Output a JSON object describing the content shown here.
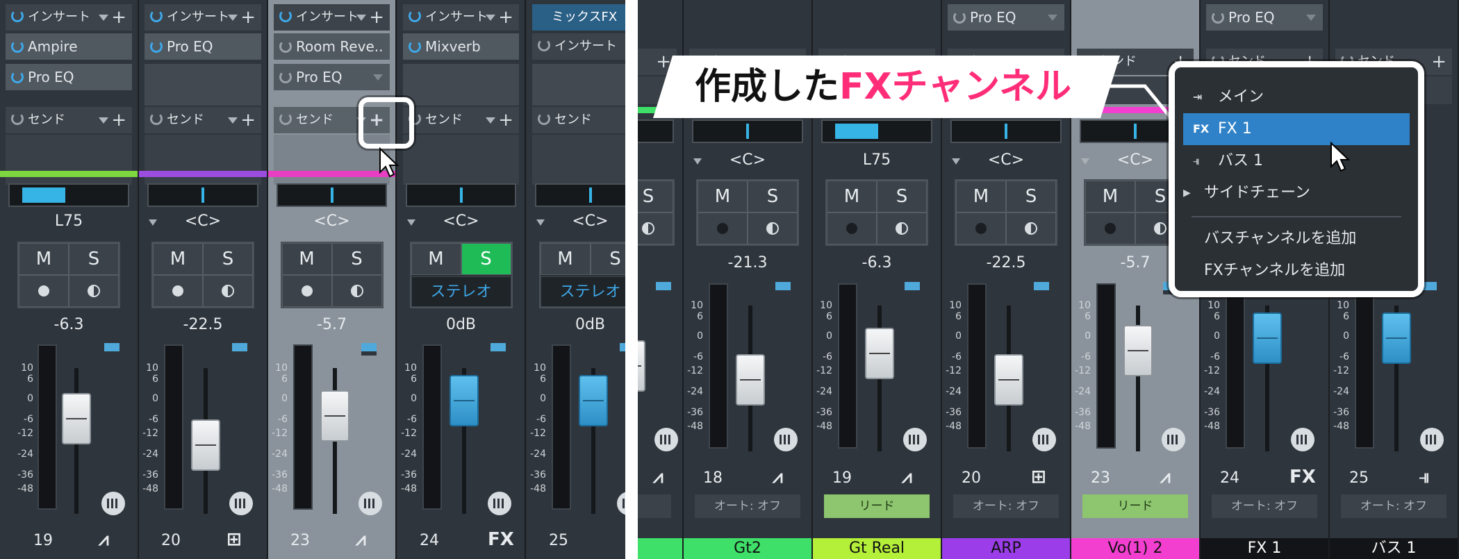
{
  "left": {
    "strips": [
      {
        "insert_label": "インサート",
        "plugins": [
          "Ampire",
          "Pro EQ"
        ],
        "send_label": "センド",
        "color": "#7ed640",
        "pan_label": "L75",
        "mute": "M",
        "solo": "S",
        "volume": "-6.3",
        "scale": [
          "10",
          "6",
          "0",
          "-6",
          "-12",
          "-24",
          "-36",
          "-48"
        ],
        "number": "19",
        "type_icon": "waveform-icon"
      },
      {
        "insert_label": "インサート",
        "plugins": [
          "Pro EQ"
        ],
        "send_label": "センド",
        "color": "#9b4de0",
        "pan_label": "<C>",
        "mute": "M",
        "solo": "S",
        "volume": "-22.5",
        "scale": [
          "10",
          "6",
          "0",
          "-6",
          "-12",
          "-24",
          "-36",
          "-48"
        ],
        "number": "20",
        "type_icon": "keyboard-icon"
      },
      {
        "insert_label": "インサート",
        "plugins": [
          "Room Reve..",
          "Pro EQ"
        ],
        "send_label": "センド",
        "color": "#e83ec2",
        "pan_label": "<C>",
        "mute": "M",
        "solo": "S",
        "volume": "-5.7",
        "scale": [
          "10",
          "6",
          "0",
          "-6",
          "-12",
          "-24",
          "-36",
          "-48"
        ],
        "number": "23",
        "type_icon": "waveform-icon"
      },
      {
        "insert_label": "インサート",
        "plugins": [
          "Mixverb"
        ],
        "send_label": "センド",
        "color": "#2c3137",
        "pan_label": "<C>",
        "mute": "M",
        "solo": "S",
        "stereo": "ステレオ",
        "volume": "0dB",
        "scale": [
          "10",
          "6",
          "0",
          "-6",
          "-12",
          "-24",
          "-36",
          "-48"
        ],
        "number": "24",
        "type_icon": "FX"
      },
      {
        "header": "ミックスFX",
        "insert_label": "インサート",
        "send_label": "センド",
        "color": "#2c3137",
        "pan_label": "<C>",
        "mute": "M",
        "solo": "S",
        "stereo": "ステレオ",
        "volume": "0dB",
        "scale": [
          "10",
          "6",
          "0",
          "-6",
          "-12",
          "-24",
          "-36",
          "-48"
        ],
        "number": "25"
      }
    ]
  },
  "right": {
    "top_plugins": [
      "Pro EQ",
      "Pro EQ"
    ],
    "send_label": "センド",
    "strips": [
      {
        "pan_label": "",
        "mute": "",
        "solo": "S",
        "volume": "",
        "number": "",
        "name": "",
        "auto": "オフ",
        "color": "#3fe06a"
      },
      {
        "pan_label": "<C>",
        "mute": "M",
        "solo": "S",
        "volume": "-21.3",
        "number": "18",
        "name": "Gt2",
        "auto": "オート: オフ",
        "color": "#3fe06a",
        "type_icon": "waveform-icon"
      },
      {
        "pan_label": "L75",
        "mute": "M",
        "solo": "S",
        "volume": "-6.3",
        "number": "19",
        "name": "Gt Real",
        "auto": "リード",
        "color": "#b4ef3a",
        "type_icon": "waveform-icon"
      },
      {
        "pan_label": "<C>",
        "mute": "M",
        "solo": "S",
        "volume": "-22.5",
        "number": "20",
        "name": "ARP",
        "auto": "オート: オフ",
        "color": "#9b3de8",
        "type_icon": "keyboard-icon"
      },
      {
        "pan_label": "<C>",
        "mute": "M",
        "solo": "S",
        "volume": "-5.7",
        "number": "23",
        "name": "Vo(1) 2",
        "auto": "リード",
        "color": "#f23fd0",
        "type_icon": "waveform-icon"
      },
      {
        "pan_label": "",
        "mute": "",
        "solo": "",
        "volume": "",
        "number": "24",
        "name": "FX 1",
        "auto": "オート: オフ",
        "color": "#121417",
        "type_icon": "FX"
      },
      {
        "pan_label": "",
        "mute": "",
        "solo": "",
        "volume": "",
        "number": "25",
        "name": "バス 1",
        "auto": "オート: オフ",
        "color": "#121417",
        "type_icon": "bus-icon"
      }
    ],
    "scale": [
      "10",
      "6",
      "0",
      "-6",
      "-12",
      "-24",
      "-36",
      "-48"
    ],
    "callout": {
      "prefix": "作成した",
      "highlight": "FXチャンネル"
    },
    "menu": {
      "items": [
        {
          "icon": "main-out-icon",
          "label": "メイン"
        },
        {
          "icon": "FX",
          "label": "FX 1",
          "selected": true
        },
        {
          "icon": "bus-icon",
          "label": "バス 1"
        },
        {
          "label": "サイドチェーン",
          "submenu": true
        }
      ],
      "actions": [
        "バスチャンネルを追加",
        "FXチャンネルを追加"
      ]
    }
  }
}
